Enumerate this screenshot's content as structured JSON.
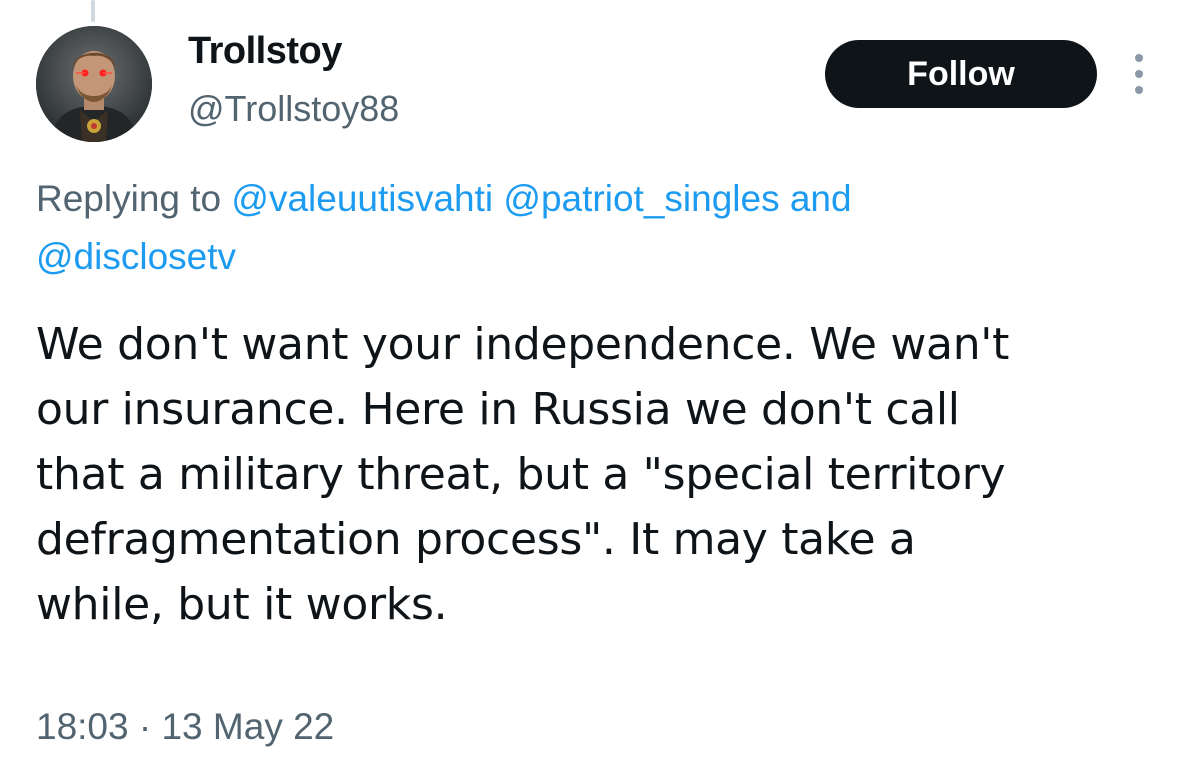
{
  "author": {
    "display_name": "Trollstoy",
    "handle": "@Trollstoy88"
  },
  "actions": {
    "follow_label": "Follow"
  },
  "reply_context": {
    "prefix": "Replying to",
    "mentions": [
      "@valeuutisvahti",
      "@patriot_singles",
      "@disclosetv"
    ],
    "conjunction": "and"
  },
  "tweet": {
    "lines": [
      "We don't want your independence. We wan't",
      "our insurance. Here in Russia we don't call",
      "that a military threat, but a \"special territory",
      "defragmentation process\". It may take a",
      "while, but it works."
    ],
    "time": "18:03",
    "separator": "·",
    "date": "13 May 22"
  },
  "colors": {
    "text_primary": "#0f1419",
    "text_secondary": "#536471",
    "link": "#1d9bf0",
    "follow_bg": "#0f1419"
  },
  "icons": {
    "more": "more-vertical-icon"
  }
}
